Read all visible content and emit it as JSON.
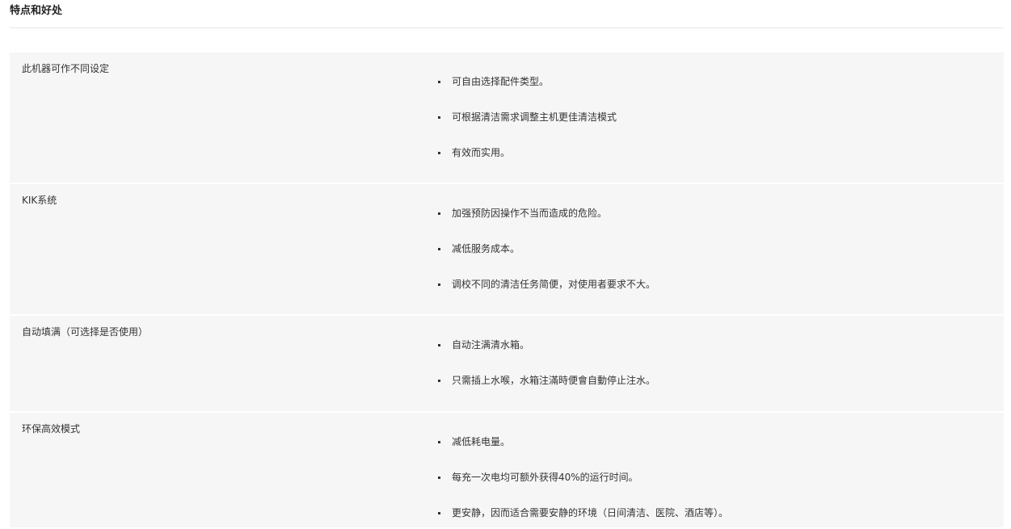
{
  "section": {
    "title": "特点和好处"
  },
  "features": [
    {
      "name": "此机器可作不同设定",
      "benefits": [
        "可自由选择配件类型。",
        "可根据清洁需求调整主机更佳清洁模式",
        "有效而实用。"
      ]
    },
    {
      "name": "KIK系统",
      "benefits": [
        "加强预防因操作不当而造成的危险。",
        "减低服务成本。",
        "调校不同的清洁任务简便，对使用者要求不大。"
      ]
    },
    {
      "name": "自动填满（可选择是否使用）",
      "benefits": [
        "自动注满清水箱。",
        "只需插上水喉，水箱注滿時便會自動停止注水。"
      ]
    },
    {
      "name": "环保高效模式",
      "benefits": [
        "减低耗电量。",
        "每充一次电均可额外获得40%的运行时间。",
        "更安静，因而适合需要安静的环境（日间清洁、医院、酒店等）。"
      ]
    }
  ]
}
